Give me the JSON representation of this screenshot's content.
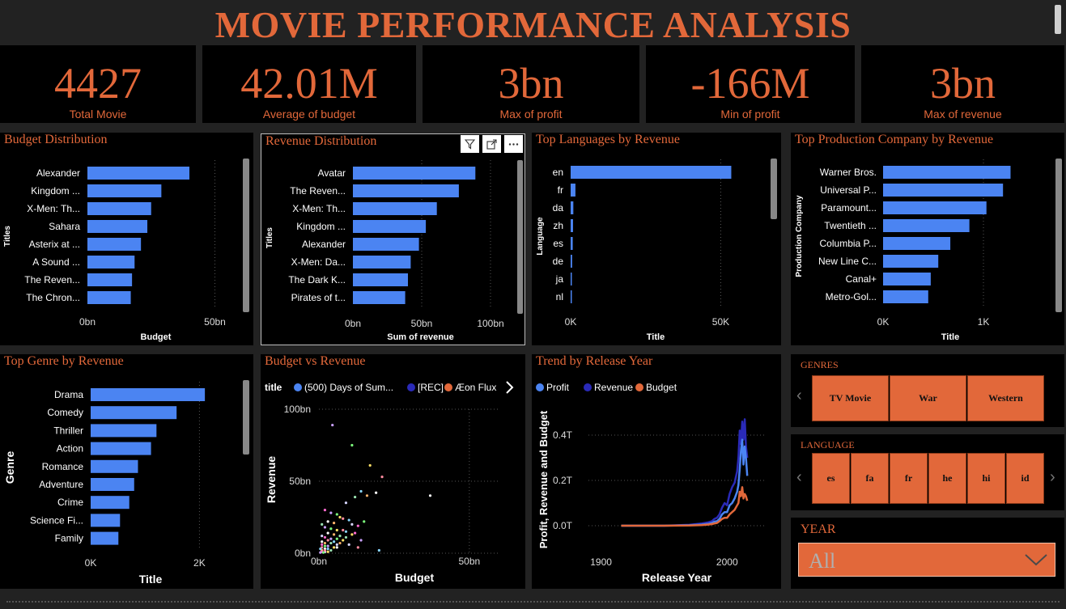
{
  "title": "MOVIE PERFORMANCE ANALYSIS",
  "kpis": [
    {
      "value": "4427",
      "label": "Total Movie"
    },
    {
      "value": "42.01M",
      "label": "Average of budget"
    },
    {
      "value": "3bn",
      "label": "Max of profit"
    },
    {
      "value": "-166M",
      "label": "Min of profit"
    },
    {
      "value": "3bn",
      "label": "Max of revenue"
    }
  ],
  "panels": {
    "budget_dist": "Budget Distribution",
    "revenue_dist": "Revenue Distribution",
    "top_lang": "Top Languages by Revenue",
    "top_company": "Top Production Company by Revenue",
    "top_genre": "Top Genre by Revenue",
    "budget_vs_revenue": "Budget vs Revenue",
    "trend": "Trend by Release Year"
  },
  "colors": {
    "accent": "#E2683A",
    "bar": "#4B84F2",
    "profit": "#4B84F2",
    "revenue": "#2A2AB8",
    "budget": "#E2683A"
  },
  "icons": {
    "filter": "filter-icon",
    "focus": "focus-mode-icon",
    "more": "more-options-icon"
  },
  "chart_data": [
    {
      "id": "budget_dist",
      "type": "bar",
      "orientation": "horizontal",
      "categories": [
        "Alexander",
        "Kingdom ...",
        "X-Men: Th...",
        "Sahara",
        "Asterix at ...",
        "A Sound ...",
        "The Reven...",
        "The Chron..."
      ],
      "values": [
        40,
        29,
        25,
        23.5,
        21,
        18.5,
        17.5,
        17
      ],
      "xlabel": "Budget",
      "ylabel": "Titles",
      "xlim": [
        0,
        60
      ],
      "xticks": [
        0,
        50
      ],
      "tick_labels": [
        "0bn",
        "50bn"
      ]
    },
    {
      "id": "revenue_dist",
      "type": "bar",
      "orientation": "horizontal",
      "categories": [
        "Avatar",
        "The Reven...",
        "X-Men: Th...",
        "Kingdom ...",
        "Alexander",
        "X-Men: Da...",
        "The Dark K...",
        "Pirates of t..."
      ],
      "values": [
        89,
        77,
        61,
        53,
        48,
        42,
        40,
        38
      ],
      "xlabel": "Sum of revenue",
      "ylabel": "Titles",
      "xlim": [
        0,
        110
      ],
      "xticks": [
        0,
        50,
        100
      ],
      "tick_labels": [
        "0bn",
        "50bn",
        "100bn"
      ]
    },
    {
      "id": "top_lang",
      "type": "bar",
      "orientation": "horizontal",
      "categories": [
        "en",
        "fr",
        "da",
        "zh",
        "es",
        "de",
        "ja",
        "nl"
      ],
      "values": [
        53500,
        1600,
        900,
        800,
        700,
        500,
        400,
        300
      ],
      "xlabel": "Title",
      "ylabel": "Language",
      "xlim": [
        0,
        62000
      ],
      "xticks": [
        0,
        50000
      ],
      "tick_labels": [
        "0K",
        "50K"
      ]
    },
    {
      "id": "top_company",
      "type": "bar",
      "orientation": "horizontal",
      "categories": [
        "Warner Bros.",
        "Universal P...",
        "Paramount...",
        "Twentieth ...",
        "Columbia P...",
        "New Line C...",
        "Canal+",
        "Metro-Gol..."
      ],
      "values": [
        1270,
        1195,
        1030,
        860,
        670,
        550,
        475,
        450
      ],
      "xlabel": "Title",
      "ylabel": "Production Company",
      "xlim": [
        0,
        1500
      ],
      "xticks": [
        0,
        1000
      ],
      "tick_labels": [
        "0K",
        "1K"
      ]
    },
    {
      "id": "top_genre",
      "type": "bar",
      "orientation": "horizontal",
      "categories": [
        "Drama",
        "Comedy",
        "Thriller",
        "Action",
        "Romance",
        "Adventure",
        "Crime",
        "Science Fi...",
        "Family"
      ],
      "values": [
        2100,
        1580,
        1210,
        1110,
        870,
        800,
        710,
        540,
        510
      ],
      "xlabel": "Title",
      "ylabel": "Genre",
      "xlim": [
        0,
        2500
      ],
      "xticks": [
        0,
        2000
      ],
      "tick_labels": [
        "0K",
        "2K"
      ]
    },
    {
      "id": "budget_vs_revenue",
      "type": "scatter",
      "legend_title": "title",
      "legend": [
        "(500) Days of Sum...",
        "[REC]",
        "Æon Flux"
      ],
      "legend_colors": [
        "#4B84F2",
        "#2A2AB8",
        "#E2683A"
      ],
      "xlabel": "Budget",
      "ylabel": "Revenue",
      "xlim": [
        0,
        60
      ],
      "ylim": [
        0,
        100
      ],
      "xticks": [
        0,
        50
      ],
      "xtick_labels": [
        "0bn",
        "50bn"
      ],
      "yticks": [
        0,
        50,
        100
      ],
      "ytick_labels": [
        "0bn",
        "50bn",
        "100bn"
      ],
      "points": [
        [
          4.5,
          89
        ],
        [
          11,
          75
        ],
        [
          17,
          61
        ],
        [
          21,
          53
        ],
        [
          14,
          43
        ],
        [
          19,
          42
        ],
        [
          16,
          40
        ],
        [
          12,
          39
        ],
        [
          9,
          35
        ],
        [
          2,
          30
        ],
        [
          4,
          28
        ],
        [
          6,
          27
        ],
        [
          7,
          25
        ],
        [
          8,
          24
        ],
        [
          10,
          23
        ],
        [
          3,
          22
        ],
        [
          5,
          21
        ],
        [
          1,
          20
        ],
        [
          11,
          20
        ],
        [
          13,
          19
        ],
        [
          2,
          18
        ],
        [
          4,
          17
        ],
        [
          6,
          16
        ],
        [
          8,
          16
        ],
        [
          9,
          15
        ],
        [
          3,
          14
        ],
        [
          5,
          13
        ],
        [
          7,
          12
        ],
        [
          1,
          12
        ],
        [
          2,
          11
        ],
        [
          4,
          10
        ],
        [
          6,
          10
        ],
        [
          8,
          9
        ],
        [
          3,
          9
        ],
        [
          5,
          8
        ],
        [
          1,
          8
        ],
        [
          2,
          7
        ],
        [
          4,
          7
        ],
        [
          6,
          6
        ],
        [
          1,
          6
        ],
        [
          3,
          5
        ],
        [
          2,
          5
        ],
        [
          5,
          4
        ],
        [
          1,
          4
        ],
        [
          3,
          3
        ],
        [
          2,
          3
        ],
        [
          1,
          2
        ],
        [
          4,
          2
        ],
        [
          2,
          1
        ],
        [
          1,
          1
        ],
        [
          0.5,
          0.5
        ],
        [
          1.5,
          0.5
        ],
        [
          3,
          1
        ],
        [
          2,
          2
        ],
        [
          0.5,
          3
        ],
        [
          6,
          4
        ],
        [
          7,
          7
        ],
        [
          9,
          11
        ],
        [
          10,
          6
        ],
        [
          12,
          14
        ],
        [
          14,
          9
        ],
        [
          15,
          22
        ],
        [
          11,
          13
        ],
        [
          13,
          4
        ],
        [
          20,
          2
        ],
        [
          37,
          40
        ]
      ],
      "point_colors": [
        "#c9a0ff",
        "#7cfc7c",
        "#ffe066",
        "#ff8ca0",
        "#8ad7ff",
        "#ffffff",
        "#ffb36b",
        "#9be3b2",
        "#d7d7ff",
        "#ff6bd0"
      ]
    },
    {
      "id": "trend",
      "type": "line",
      "legend": [
        "Profit",
        "Revenue",
        "Budget"
      ],
      "xlabel": "Release Year",
      "ylabel": "Profit, Revenue and Budget",
      "xlim": [
        1890,
        2030
      ],
      "ylim": [
        -0.05,
        0.55
      ],
      "xticks": [
        1900,
        2000
      ],
      "xtick_labels": [
        "1900",
        "2000"
      ],
      "yticks": [
        0,
        0.2,
        0.4
      ],
      "ytick_labels": [
        "0.0T",
        "0.2T",
        "0.4T"
      ],
      "x": [
        1916,
        1930,
        1950,
        1970,
        1980,
        1985,
        1988,
        1990,
        1992,
        1994,
        1996,
        1998,
        2000,
        2002,
        2004,
        2006,
        2008,
        2009,
        2010,
        2011,
        2012,
        2013,
        2014,
        2015,
        2016
      ],
      "series": [
        {
          "name": "Profit",
          "values": [
            0,
            0,
            0,
            0.002,
            0.005,
            0.008,
            0.012,
            0.018,
            0.02,
            0.03,
            0.05,
            0.06,
            0.06,
            0.09,
            0.1,
            0.12,
            0.15,
            0.18,
            0.25,
            0.33,
            0.38,
            0.27,
            0.35,
            0.3,
            0.22
          ]
        },
        {
          "name": "Revenue",
          "values": [
            0,
            0,
            0,
            0.004,
            0.01,
            0.015,
            0.02,
            0.03,
            0.035,
            0.05,
            0.08,
            0.1,
            0.09,
            0.14,
            0.17,
            0.19,
            0.24,
            0.3,
            0.42,
            0.36,
            0.46,
            0.38,
            0.47,
            0.35,
            0.3
          ]
        },
        {
          "name": "Budget",
          "values": [
            0,
            0,
            0,
            0.001,
            0.003,
            0.005,
            0.007,
            0.01,
            0.012,
            0.02,
            0.03,
            0.035,
            0.035,
            0.05,
            0.06,
            0.07,
            0.09,
            0.1,
            0.15,
            0.13,
            0.17,
            0.12,
            0.14,
            0.13,
            0.11
          ]
        }
      ]
    }
  ],
  "slicers": {
    "genres": {
      "label": "GENRES",
      "items": [
        "TV Movie",
        "War",
        "Western"
      ]
    },
    "language": {
      "label": "LANGUAGE",
      "items": [
        "es",
        "fa",
        "fr",
        "he",
        "hi",
        "id"
      ]
    },
    "year": {
      "label": "YEAR",
      "value": "All"
    }
  }
}
